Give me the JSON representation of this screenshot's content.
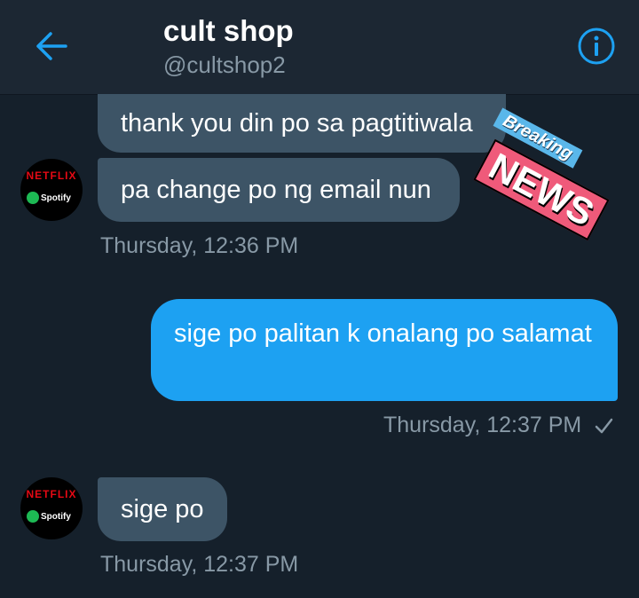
{
  "header": {
    "title": "cult shop",
    "handle": "@cultshop2",
    "back_icon": "arrow-left-icon",
    "info_icon": "info-icon",
    "accent": "#1da1f2"
  },
  "messages": [
    {
      "side": "in",
      "text": "thank you din po sa pagtitiwala"
    },
    {
      "side": "in",
      "text": "pa change po ng email nun"
    },
    {
      "side": "out",
      "text": "sige po palitan k onalang po salamat"
    },
    {
      "side": "in",
      "text": "sige po"
    }
  ],
  "timestamps": {
    "t1": "Thursday, 12:36 PM",
    "t2": "Thursday, 12:37 PM",
    "t3": "Thursday, 12:37 PM"
  },
  "avatar": {
    "brand1": "NETFLIX",
    "brand2": "Spotify"
  },
  "sticker": {
    "line1": "Breaking",
    "line2": "NEWS"
  },
  "colors": {
    "background": "#15202b",
    "header": "#1c2733",
    "incoming_bubble": "#3d5466",
    "outgoing_bubble": "#1da1f2",
    "muted": "#8899a6"
  }
}
